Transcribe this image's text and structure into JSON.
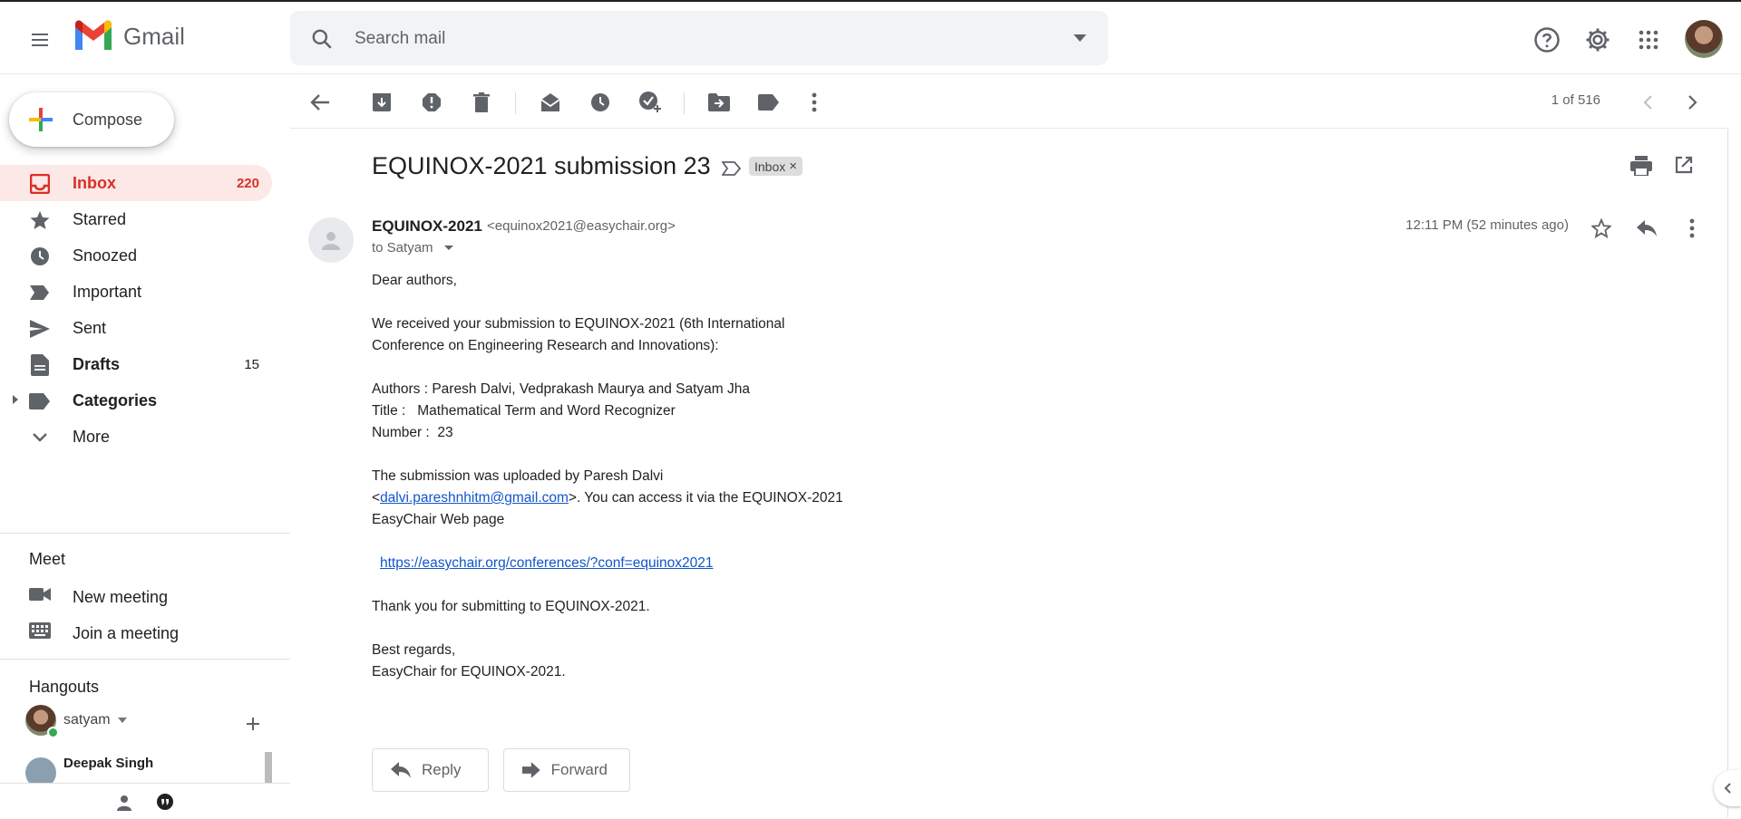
{
  "app": {
    "name": "Gmail"
  },
  "search": {
    "placeholder": "Search mail"
  },
  "compose": {
    "label": "Compose"
  },
  "nav": [
    {
      "label": "Inbox",
      "count": "220",
      "icon": "inbox-icon",
      "active": true
    },
    {
      "label": "Starred",
      "count": "",
      "icon": "star-icon"
    },
    {
      "label": "Snoozed",
      "count": "",
      "icon": "clock-icon"
    },
    {
      "label": "Important",
      "count": "",
      "icon": "important-icon"
    },
    {
      "label": "Sent",
      "count": "",
      "icon": "send-icon"
    },
    {
      "label": "Drafts",
      "count": "15",
      "icon": "draft-icon",
      "bold": true
    },
    {
      "label": "Categories",
      "count": "",
      "icon": "label-icon",
      "bold": true
    },
    {
      "label": "More",
      "count": "",
      "icon": "chevron-down-icon"
    }
  ],
  "meet": {
    "title": "Meet",
    "new_meeting": "New meeting",
    "join_meeting": "Join a meeting"
  },
  "hangouts": {
    "title": "Hangouts",
    "user": "satyam",
    "contact_name": "Deepak Singh"
  },
  "toolbar": {
    "pager": "1 of 516"
  },
  "email": {
    "subject": "EQUINOX-2021 submission 23",
    "label_chip": "Inbox",
    "sender_name": "EQUINOX-2021",
    "sender_email": "<equinox2021@easychair.org>",
    "to": "to Satyam",
    "time": "12:11 PM (52 minutes ago)",
    "body": {
      "l1": "Dear authors,",
      "l2": "We received your submission to EQUINOX-2021 (6th International",
      "l3": "Conference on Engineering Research and Innovations):",
      "l4": "Authors : Paresh Dalvi, Vedprakash Maurya and Satyam Jha",
      "l5": "Title :   Mathematical Term and Word Recognizer",
      "l6": "Number :  23",
      "l7": "The submission was uploaded by Paresh Dalvi",
      "l8_pre": "<",
      "l8_link": "dalvi.pareshnhitm@gmail.com",
      "l8_post": ">. You can access it via the EQUINOX-2021",
      "l9": "EasyChair Web page",
      "l10_link": "https://easychair.org/conferences/?conf=equinox2021",
      "l11": "Thank you for submitting to EQUINOX-2021.",
      "l12": "Best regards,",
      "l13": "EasyChair for EQUINOX-2021."
    },
    "reply_label": "Reply",
    "forward_label": "Forward"
  },
  "colors": {
    "accent": "#d93025",
    "active_bg": "#fce8e6",
    "link": "#1155cc"
  }
}
